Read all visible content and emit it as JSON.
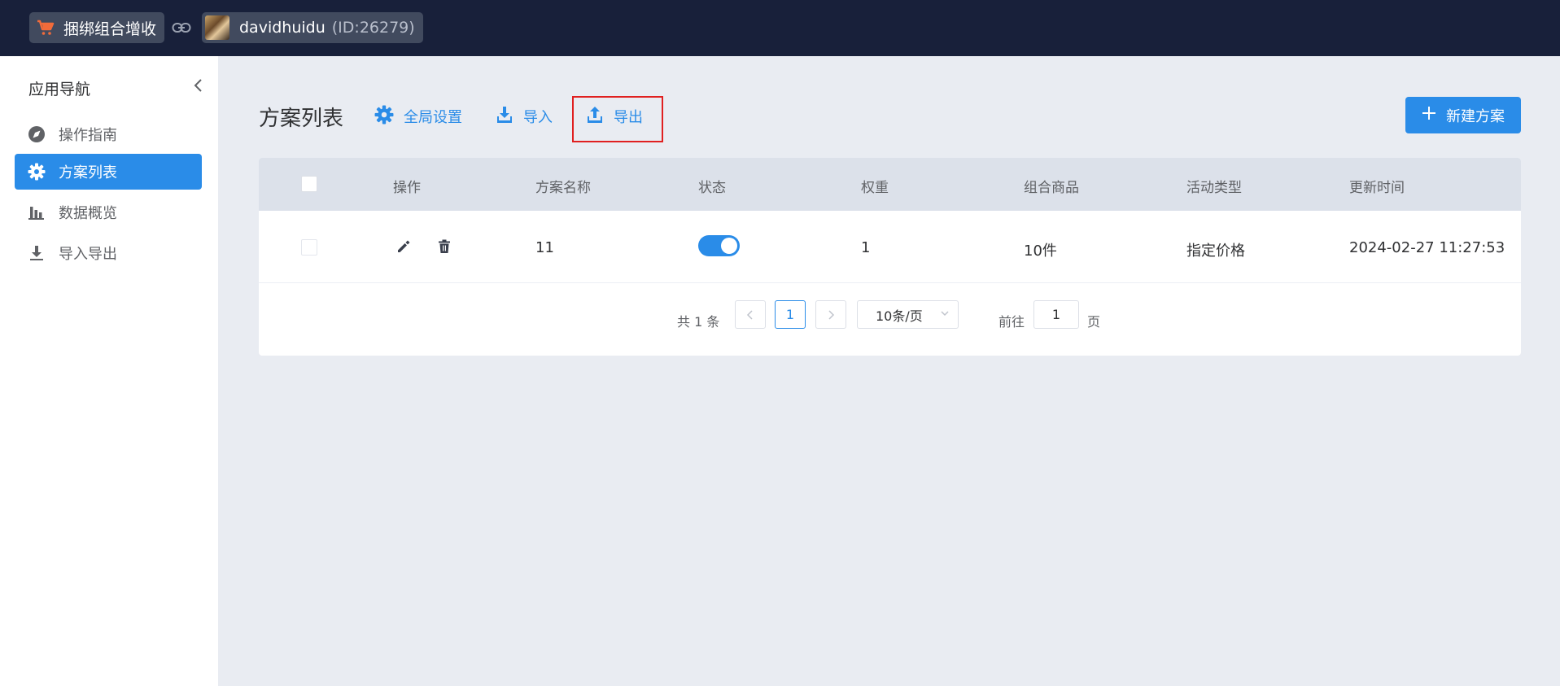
{
  "topbar": {
    "app_name": "捆绑组合增收",
    "user_name": "davidhuidu",
    "user_id": "(ID:26279)"
  },
  "sidebar": {
    "title": "应用导航",
    "items": [
      {
        "label": "操作指南",
        "icon": "compass-icon"
      },
      {
        "label": "方案列表",
        "icon": "gear-icon",
        "active": true
      },
      {
        "label": "数据概览",
        "icon": "bar-chart-icon"
      },
      {
        "label": "导入导出",
        "icon": "download-icon"
      }
    ]
  },
  "main": {
    "title": "方案列表",
    "toolbar": {
      "settings_label": "全局设置",
      "import_label": "导入",
      "export_label": "导出",
      "new_label": "新建方案"
    },
    "table": {
      "columns": [
        "操作",
        "方案名称",
        "状态",
        "权重",
        "组合商品",
        "活动类型",
        "更新时间"
      ],
      "rows": [
        {
          "name": "11",
          "status_on": true,
          "weight": "1",
          "products": "10件",
          "activity_type": "指定价格",
          "updated": "2024-02-27 11:27:53"
        }
      ]
    },
    "pagination": {
      "total": "共 1 条",
      "current_page": "1",
      "page_size": "10条/页",
      "goto_label": "前往",
      "goto_value": "1",
      "goto_suffix": "页"
    }
  },
  "colors": {
    "accent": "#2a8ce8",
    "topbar_bg": "#18203a",
    "highlight_border": "#e02020"
  }
}
